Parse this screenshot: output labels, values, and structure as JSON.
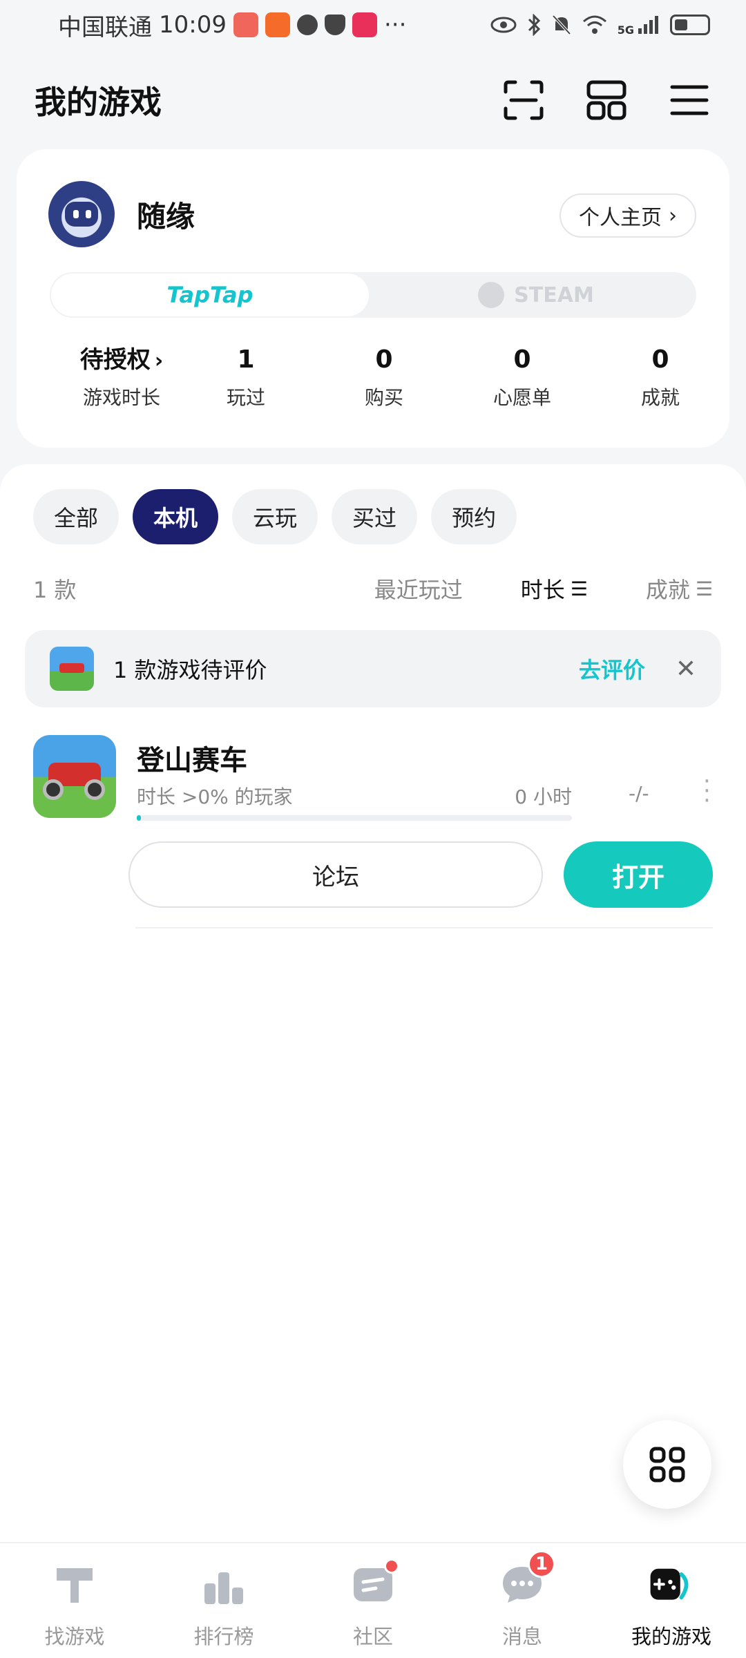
{
  "status_bar": {
    "carrier": "中国联通",
    "time": "10:09",
    "more": "···",
    "network": "5G"
  },
  "header": {
    "title": "我的游戏",
    "icons": [
      "scan-icon",
      "layout-icon",
      "menu-icon"
    ]
  },
  "profile": {
    "username": "随缘",
    "profile_button": "个人主页",
    "platforms": {
      "taptap": "TapTap",
      "steam": "STEAM"
    },
    "stats": [
      {
        "value": "待授权",
        "label": "游戏时长"
      },
      {
        "value": "1",
        "label": "玩过"
      },
      {
        "value": "0",
        "label": "购买"
      },
      {
        "value": "0",
        "label": "心愿单"
      },
      {
        "value": "0",
        "label": "成就"
      }
    ]
  },
  "filters": {
    "chips": [
      "全部",
      "本机",
      "云玩",
      "买过",
      "预约"
    ],
    "active": "本机"
  },
  "sort": {
    "count": "1 款",
    "options": [
      "最近玩过",
      "时长",
      "成就"
    ],
    "active": "时长"
  },
  "review_banner": {
    "text": "1 款游戏待评价",
    "action": "去评价"
  },
  "games": [
    {
      "title": "登山赛车",
      "playtime_stat": "时长 >0% 的玩家",
      "hours": "0 小时",
      "achievements": "-/-",
      "progress": 0.01,
      "forum_label": "论坛",
      "open_label": "打开"
    }
  ],
  "bottom_nav": {
    "items": [
      {
        "label": "找游戏",
        "icon": "hammer-icon"
      },
      {
        "label": "排行榜",
        "icon": "podium-icon"
      },
      {
        "label": "社区",
        "icon": "community-icon"
      },
      {
        "label": "消息",
        "icon": "chat-bubble-icon",
        "badge": "1"
      },
      {
        "label": "我的游戏",
        "icon": "gamepad-icon"
      }
    ],
    "active": "我的游戏"
  },
  "colors": {
    "accent": "#15c5ce",
    "open_button": "#15c9bd",
    "active_chip": "#1c1f6e",
    "badge": "#f25050"
  }
}
